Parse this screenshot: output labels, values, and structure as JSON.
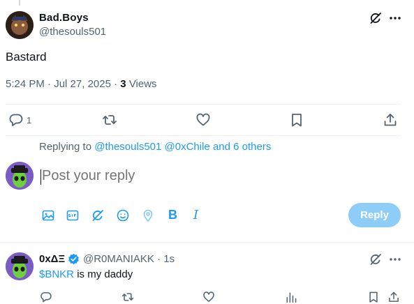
{
  "post": {
    "display_name": "Bad.Boys",
    "handle": "@thesouls501",
    "text": "Bastard",
    "time": "5:24 PM",
    "date": "Jul 27, 2025",
    "views_count": "3",
    "views_label": "Views",
    "reply_count": "1"
  },
  "replying": {
    "prefix": "Replying to",
    "mentions": "@thesouls501 @0xChile",
    "and_text": "and 6 others"
  },
  "compose": {
    "placeholder": "Post your reply",
    "bold_label": "B",
    "italic_label": "I",
    "reply_button": "Reply"
  },
  "reply": {
    "display_name": "0xΔΞ",
    "handle": "@R0MANIAKK",
    "time": "1s",
    "cashtag": "$BNKR",
    "text_rest": " is my daddy"
  },
  "colors": {
    "accent": "#1d9bf0",
    "muted": "#536471",
    "reply_button_disabled": "#8ecdf8",
    "divider": "#eff3f4"
  },
  "icons": {
    "reply": "speech-bubble-icon",
    "repost": "repost-arrows-icon",
    "like": "heart-icon",
    "bookmark": "bookmark-icon",
    "share": "share-upload-icon",
    "grok": "grok-icon",
    "more": "ellipsis-icon",
    "media": "image-icon",
    "gif": "gif-icon",
    "poll": "grok-slash-icon",
    "emoji": "smile-icon",
    "location": "location-pin-icon",
    "analytics": "bar-chart-icon",
    "verified": "verified-badge-icon"
  }
}
